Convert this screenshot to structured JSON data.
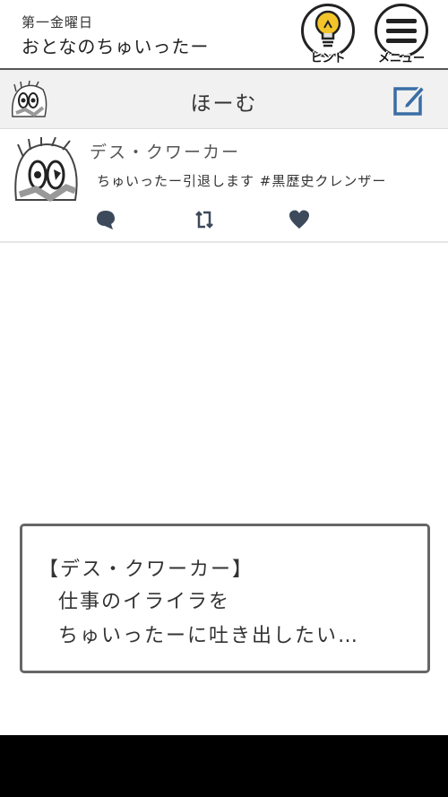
{
  "header": {
    "chapter": "第一金曜日",
    "title": "おとなのちゅいったー",
    "hint_label": "ヒント",
    "menu_label": "メニュー"
  },
  "app": {
    "home_title": "ほーむ"
  },
  "post": {
    "username": "デス・クワーカー",
    "text": "ちゅいったー引退します #黒歴史クレンザー"
  },
  "dialogue": {
    "speaker": "【デス・クワーカー】",
    "line1": "仕事のイライラを",
    "line2": "ちゅいったーに吐き出したい…"
  },
  "colors": {
    "accent_blue": "#3a6ea5",
    "icon_dark": "#3d4a5c",
    "bulb_yellow": "#f3c52b"
  }
}
